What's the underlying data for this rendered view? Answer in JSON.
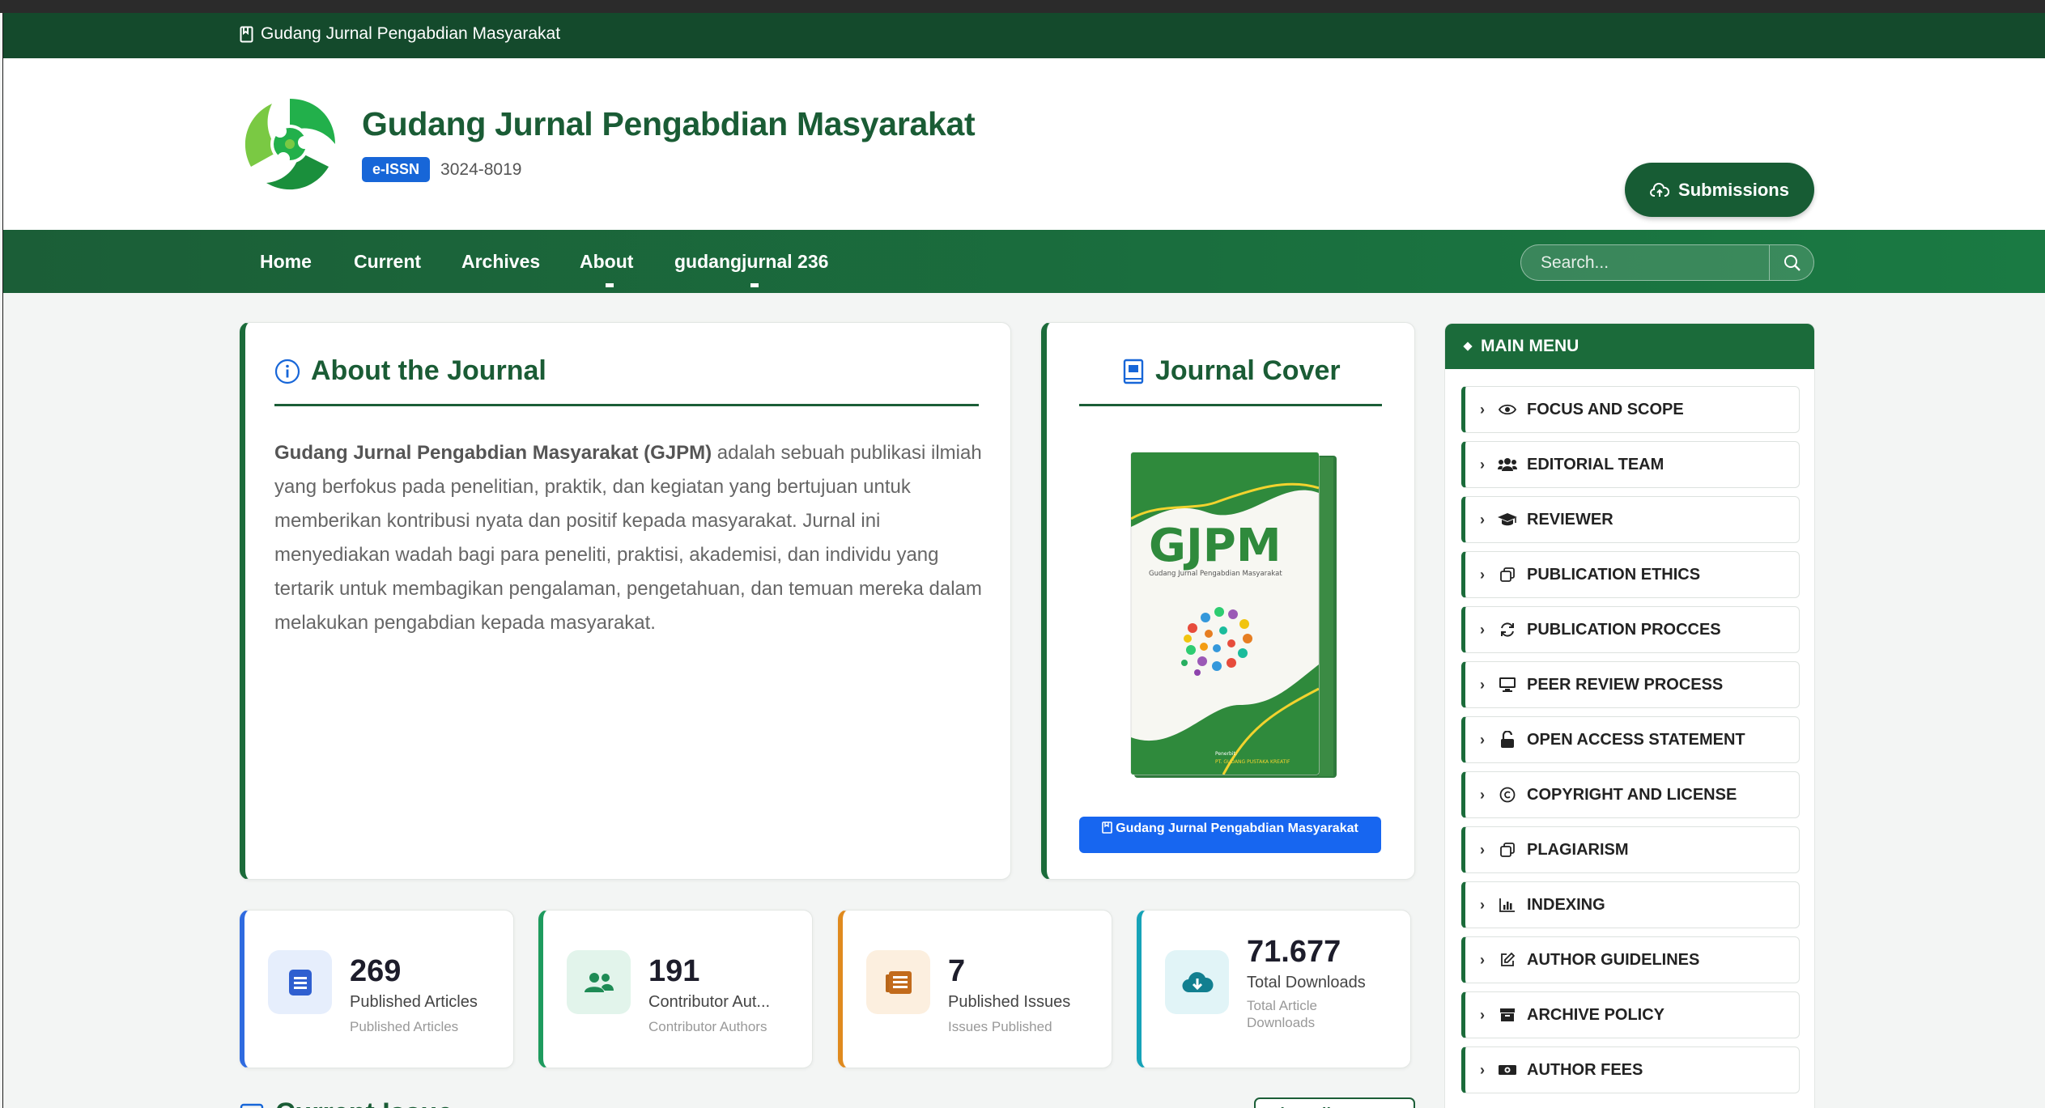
{
  "topbar": {
    "text": "Gudang Jurnal Pengabdian Masyarakat"
  },
  "header": {
    "title": "Gudang Jurnal Pengabdian Masyarakat",
    "issn_label": "e-ISSN",
    "issn_value": "3024-8019",
    "submit_label": "Submissions"
  },
  "nav": {
    "items": [
      "Home",
      "Current",
      "Archives",
      "About",
      "gudangjurnal 236"
    ],
    "search_placeholder": "Search..."
  },
  "about": {
    "heading": "About the Journal",
    "journal_name": "Gudang Jurnal Pengabdian Masyarakat (GJPM)",
    "body": " adalah sebuah publikasi ilmiah yang berfokus pada penelitian, praktik, dan kegiatan yang bertujuan untuk memberikan kontribusi nyata dan positif kepada masyarakat. Jurnal ini menyediakan wadah bagi para peneliti, praktisi, akademisi, dan individu yang tertarik untuk membagikan pengalaman, pengetahuan, dan temuan mereka dalam melakukan pengabdian kepada masyarakat."
  },
  "cover": {
    "heading": "Journal Cover",
    "book_title": "GJPM",
    "book_subtitle": "Gudang Jurnal Pengabdian Masyarakat",
    "book_publisher_label": "Penerbit:",
    "book_publisher": "PT. GUDANG PUSTAKA KREATIF",
    "button_label": "Gudang Jurnal Pengabdian Masyarakat"
  },
  "stats": [
    {
      "value": "269",
      "label": "Published Articles",
      "sub": "Published Articles",
      "color": "#2f6be0",
      "bg": "#e6eefc"
    },
    {
      "value": "191",
      "label": "Contributor Aut...",
      "sub": "Contributor Authors",
      "color": "#1e9b5e",
      "bg": "#e2f4eb"
    },
    {
      "value": "7",
      "label": "Published Issues",
      "sub": "Issues Published",
      "color": "#e08a1e",
      "bg": "#fcefdf"
    },
    {
      "value": "71.677",
      "label": "Total Downloads",
      "sub": "Total Article Downloads",
      "color": "#16a3b8",
      "bg": "#e1f4f7"
    }
  ],
  "current_issue": {
    "heading": "Current Issue",
    "view_all": "View All Issues »"
  },
  "sidebar": {
    "title": "MAIN MENU",
    "items": [
      {
        "label": "FOCUS AND SCOPE",
        "icon": "eye-icon"
      },
      {
        "label": "EDITORIAL TEAM",
        "icon": "users-icon"
      },
      {
        "label": "REVIEWER",
        "icon": "graduation-cap-icon"
      },
      {
        "label": "PUBLICATION ETHICS",
        "icon": "copy-icon"
      },
      {
        "label": "PUBLICATION PROCCES",
        "icon": "refresh-icon"
      },
      {
        "label": "PEER REVIEW PROCESS",
        "icon": "monitor-icon"
      },
      {
        "label": "OPEN ACCESS STATEMENT",
        "icon": "unlock-icon"
      },
      {
        "label": "COPYRIGHT AND LICENSE",
        "icon": "copyright-icon"
      },
      {
        "label": "PLAGIARISM",
        "icon": "copy-icon"
      },
      {
        "label": "INDEXING",
        "icon": "bar-chart-icon"
      },
      {
        "label": "AUTHOR GUIDELINES",
        "icon": "edit-icon"
      },
      {
        "label": "ARCHIVE POLICY",
        "icon": "archive-icon"
      },
      {
        "label": "AUTHOR FEES",
        "icon": "money-icon"
      }
    ]
  }
}
